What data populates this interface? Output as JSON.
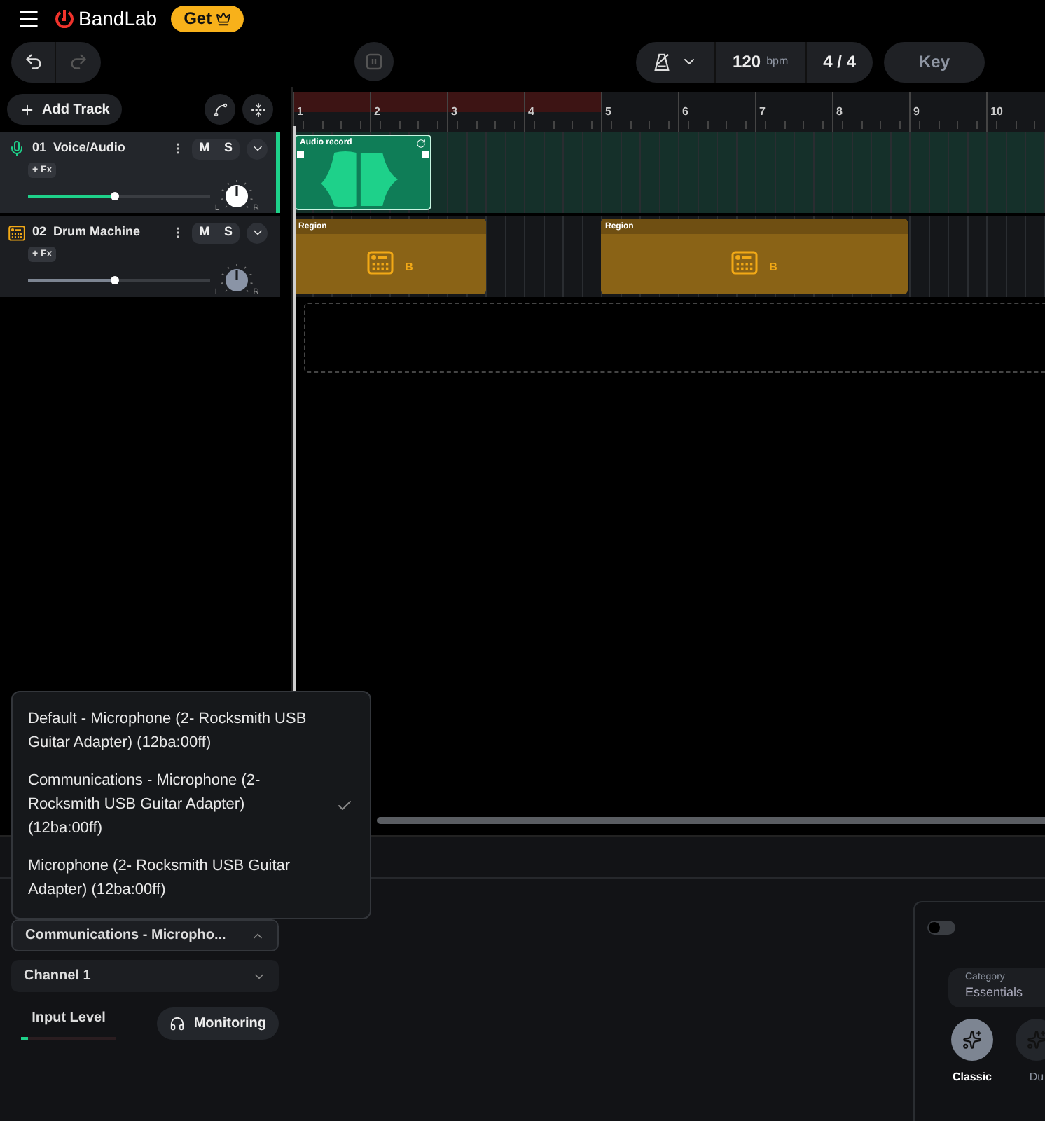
{
  "header": {
    "brand": "BandLab",
    "get_button": "Get"
  },
  "transport": {
    "tempo": "120",
    "tempo_unit": "bpm",
    "time_signature": "4 / 4",
    "key_button": "Key"
  },
  "tracks_toolbar": {
    "add_track": "Add Track"
  },
  "ruler": {
    "bars": [
      {
        "label": "1",
        "in_loop": true
      },
      {
        "label": "2",
        "in_loop": true
      },
      {
        "label": "3",
        "in_loop": true
      },
      {
        "label": "4",
        "in_loop": true
      },
      {
        "label": "5",
        "in_loop": false
      },
      {
        "label": "6",
        "in_loop": false
      },
      {
        "label": "7",
        "in_loop": false
      },
      {
        "label": "8",
        "in_loop": false
      },
      {
        "label": "9",
        "in_loop": false
      },
      {
        "label": "10",
        "in_loop": false
      }
    ]
  },
  "tracks": [
    {
      "number": "01",
      "name": "Voice/Audio",
      "kind": "audio",
      "selected": true,
      "fx": "+ Fx",
      "mute": "M",
      "solo": "S",
      "level": 0.48,
      "pan_left": "L",
      "pan_right": "R",
      "regions": [
        {
          "title": "Audio record",
          "kind": "audio"
        }
      ]
    },
    {
      "number": "02",
      "name": "Drum Machine",
      "kind": "drums",
      "selected": false,
      "fx": "+ Fx",
      "mute": "M",
      "solo": "S",
      "level": 0.48,
      "pan_left": "L",
      "pan_right": "R",
      "regions": [
        {
          "title": "Region",
          "kind": "pattern",
          "label": "B"
        },
        {
          "title": "Region",
          "kind": "pattern",
          "label": "B"
        }
      ]
    }
  ],
  "input": {
    "device_menu": [
      {
        "label": "Default - Microphone (2- Rocksmith USB Guitar Adapter) (12ba:00ff)",
        "selected": false
      },
      {
        "label": "Communications - Microphone (2- Rocksmith USB Guitar Adapter) (12ba:00ff)",
        "selected": true
      },
      {
        "label": "Microphone (2- Rocksmith USB Guitar Adapter) (12ba:00ff)",
        "selected": false
      }
    ],
    "device_select": "Communications - Micropho...",
    "expanded": true,
    "channel_select": "Channel 1",
    "input_level_label": "Input Level",
    "level": 0.07,
    "monitoring": "Monitoring"
  },
  "effects_card": {
    "toggle_on": false,
    "category_label": "Category",
    "category_value": "Essentials",
    "presets": [
      {
        "name": "Classic",
        "selected": true
      },
      {
        "name": "Du",
        "selected": false
      }
    ]
  }
}
